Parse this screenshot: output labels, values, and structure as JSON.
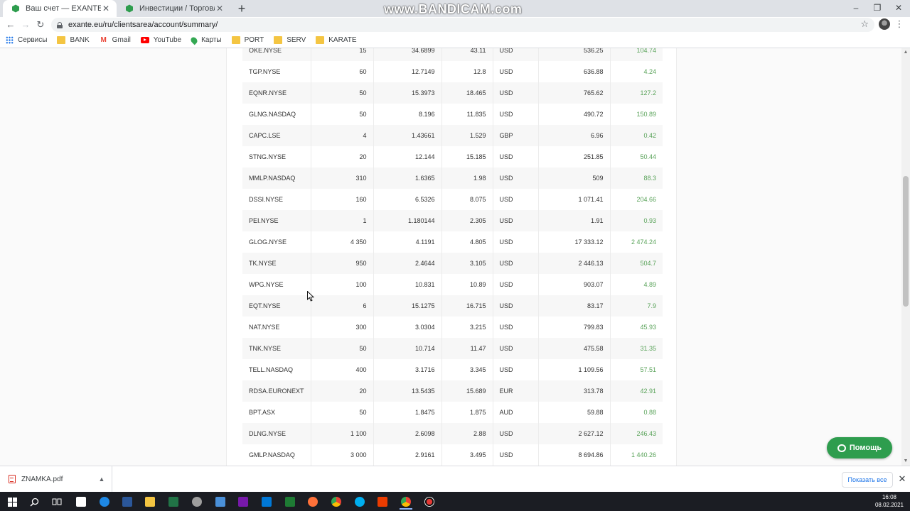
{
  "browser": {
    "tabs": [
      {
        "title": "Ваш счет — EXANTE",
        "active": true
      },
      {
        "title": "Инвестиции / Торговля — EXAN",
        "active": false
      }
    ],
    "watermark": "www.BANDICAM.com",
    "url": "exante.eu/ru/clientsarea/account/summary/",
    "bookmarks": [
      {
        "label": "Сервисы",
        "icon": "apps-icon"
      },
      {
        "label": "BANK",
        "icon": "folder-icon"
      },
      {
        "label": "Gmail",
        "icon": "gmail-icon"
      },
      {
        "label": "YouTube",
        "icon": "youtube-icon"
      },
      {
        "label": "Карты",
        "icon": "maps-icon"
      },
      {
        "label": "PORT",
        "icon": "folder-icon"
      },
      {
        "label": "SERV",
        "icon": "folder-icon"
      },
      {
        "label": "KARATE",
        "icon": "folder-icon"
      }
    ]
  },
  "positions": [
    [
      "OKE.NYSE",
      "15",
      "34.6899",
      "43.11",
      "USD",
      "536.25",
      "104.74"
    ],
    [
      "TGP.NYSE",
      "60",
      "12.7149",
      "12.8",
      "USD",
      "636.88",
      "4.24"
    ],
    [
      "EQNR.NYSE",
      "50",
      "15.3973",
      "18.465",
      "USD",
      "765.62",
      "127.2"
    ],
    [
      "GLNG.NASDAQ",
      "50",
      "8.196",
      "11.835",
      "USD",
      "490.72",
      "150.89"
    ],
    [
      "CAPC.LSE",
      "4",
      "1.43661",
      "1.529",
      "GBP",
      "6.96",
      "0.42"
    ],
    [
      "STNG.NYSE",
      "20",
      "12.144",
      "15.185",
      "USD",
      "251.85",
      "50.44"
    ],
    [
      "MMLP.NASDAQ",
      "310",
      "1.6365",
      "1.98",
      "USD",
      "509",
      "88.3"
    ],
    [
      "DSSI.NYSE",
      "160",
      "6.5326",
      "8.075",
      "USD",
      "1 071.41",
      "204.66"
    ],
    [
      "PEI.NYSE",
      "1",
      "1.180144",
      "2.305",
      "USD",
      "1.91",
      "0.93"
    ],
    [
      "GLOG.NYSE",
      "4 350",
      "4.1191",
      "4.805",
      "USD",
      "17 333.12",
      "2 474.24"
    ],
    [
      "TK.NYSE",
      "950",
      "2.4644",
      "3.105",
      "USD",
      "2 446.13",
      "504.7"
    ],
    [
      "WPG.NYSE",
      "100",
      "10.831",
      "10.89",
      "USD",
      "903.07",
      "4.89"
    ],
    [
      "EQT.NYSE",
      "6",
      "15.1275",
      "16.715",
      "USD",
      "83.17",
      "7.9"
    ],
    [
      "NAT.NYSE",
      "300",
      "3.0304",
      "3.215",
      "USD",
      "799.83",
      "45.93"
    ],
    [
      "TNK.NYSE",
      "50",
      "10.714",
      "11.47",
      "USD",
      "475.58",
      "31.35"
    ],
    [
      "TELL.NASDAQ",
      "400",
      "3.1716",
      "3.345",
      "USD",
      "1 109.56",
      "57.51"
    ],
    [
      "RDSA.EURONEXT",
      "20",
      "13.5435",
      "15.689",
      "EUR",
      "313.78",
      "42.91"
    ],
    [
      "BPT.ASX",
      "50",
      "1.8475",
      "1.875",
      "AUD",
      "59.88",
      "0.88"
    ],
    [
      "DLNG.NYSE",
      "1 100",
      "2.6098",
      "2.88",
      "USD",
      "2 627.12",
      "246.43"
    ],
    [
      "GMLP.NASDAQ",
      "3 000",
      "2.9161",
      "3.495",
      "USD",
      "8 694.86",
      "1 440.26"
    ]
  ],
  "help_button": {
    "label": "Помощь"
  },
  "download": {
    "filename": "ZNAMKA.pdf",
    "show_all": "Показать все"
  },
  "clock": {
    "time": "16:08",
    "date": "08.02.2021"
  },
  "colors": {
    "pnl_positive": "#5aa35a",
    "help_green": "#2e9d4e",
    "folder": "#f4c542"
  }
}
